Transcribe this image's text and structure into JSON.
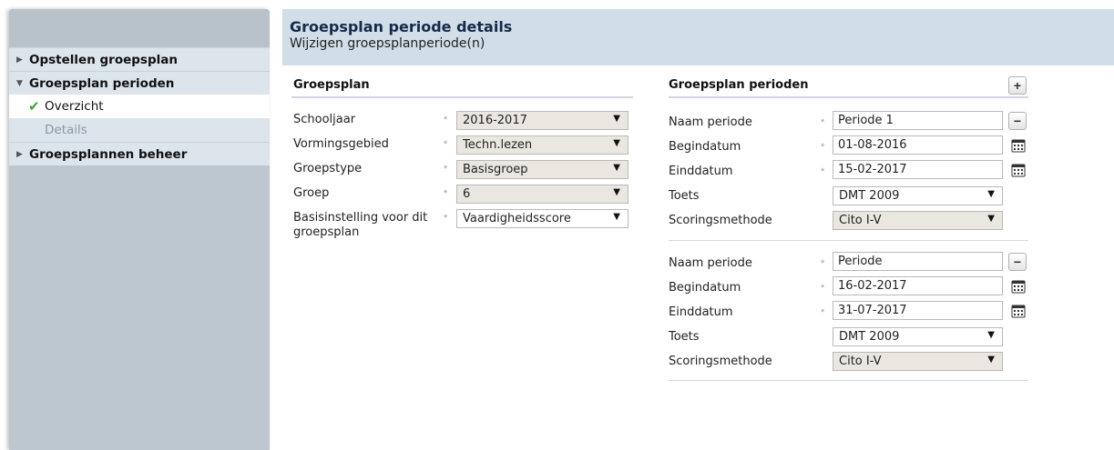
{
  "sidebar": {
    "groups": [
      {
        "label": "Opstellen groepsplan"
      },
      {
        "label": "Groepsplan perioden"
      },
      {
        "label": "Groepsplannen beheer"
      }
    ],
    "sub": {
      "overzicht": "Overzicht",
      "details": "Details"
    }
  },
  "header": {
    "title": "Groepsplan periode details",
    "subtitle": "Wijzigen groepsplanperiode(n)"
  },
  "groepsplan": {
    "title": "Groepsplan",
    "fields": [
      {
        "label": "Schooljaar",
        "value": "2016-2017"
      },
      {
        "label": "Vormingsgebied",
        "value": "Techn.lezen"
      },
      {
        "label": "Groepstype",
        "value": "Basisgroep"
      },
      {
        "label": "Groep",
        "value": "6"
      },
      {
        "label_line1": "Basisinstelling voor dit",
        "label_line2": "groepsplan",
        "value": "Vaardigheidsscore"
      }
    ],
    "required_mark": "*"
  },
  "perioden": {
    "title": "Groepsplan perioden",
    "add_symbol": "+",
    "remove_symbol": "−",
    "labels": {
      "naam": "Naam periode",
      "begin": "Begindatum",
      "eind": "Einddatum",
      "toets": "Toets",
      "scoring": "Scoringsmethode"
    },
    "items": [
      {
        "naam": "Periode 1",
        "begin": "01-08-2016",
        "eind": "15-02-2017",
        "toets": "DMT 2009",
        "scoring": "Cito I-V"
      },
      {
        "naam": "Periode",
        "begin": "16-02-2017",
        "eind": "31-07-2017",
        "toets": "DMT 2009",
        "scoring": "Cito I-V"
      }
    ]
  }
}
